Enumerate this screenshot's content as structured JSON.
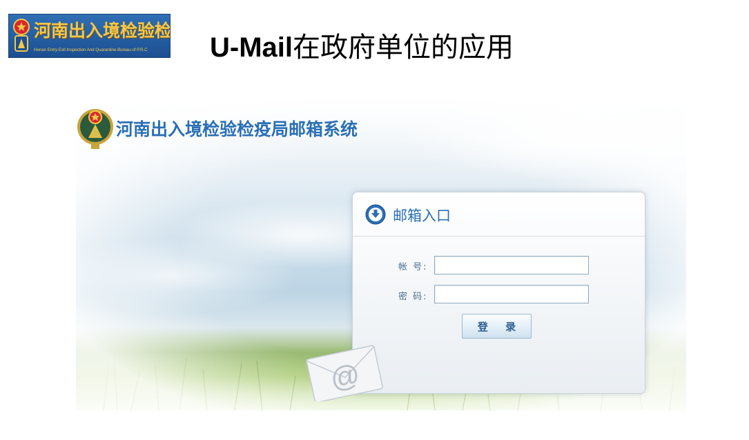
{
  "header": {
    "logo_cn": "河南出入境检验检疫局",
    "logo_en": "Henan Entry-Exit Inspection And Quarantine Bureau of P.R.C",
    "title_bold": "U-Mail",
    "title_rest": "在政府单位的应用"
  },
  "login_page": {
    "site_title": "河南出入境检验检疫局邮箱系统",
    "box_heading": "邮箱入口",
    "account_label": "帐  号:",
    "account_value": "",
    "password_label": "密  码:",
    "password_value": "",
    "login_button": "登 录"
  },
  "colors": {
    "brand_blue": "#2a6fb5",
    "logo_gold": "#f2c94c"
  },
  "icons": [
    "national-emblem-icon",
    "down-arrow-icon",
    "email-envelope-icon"
  ]
}
